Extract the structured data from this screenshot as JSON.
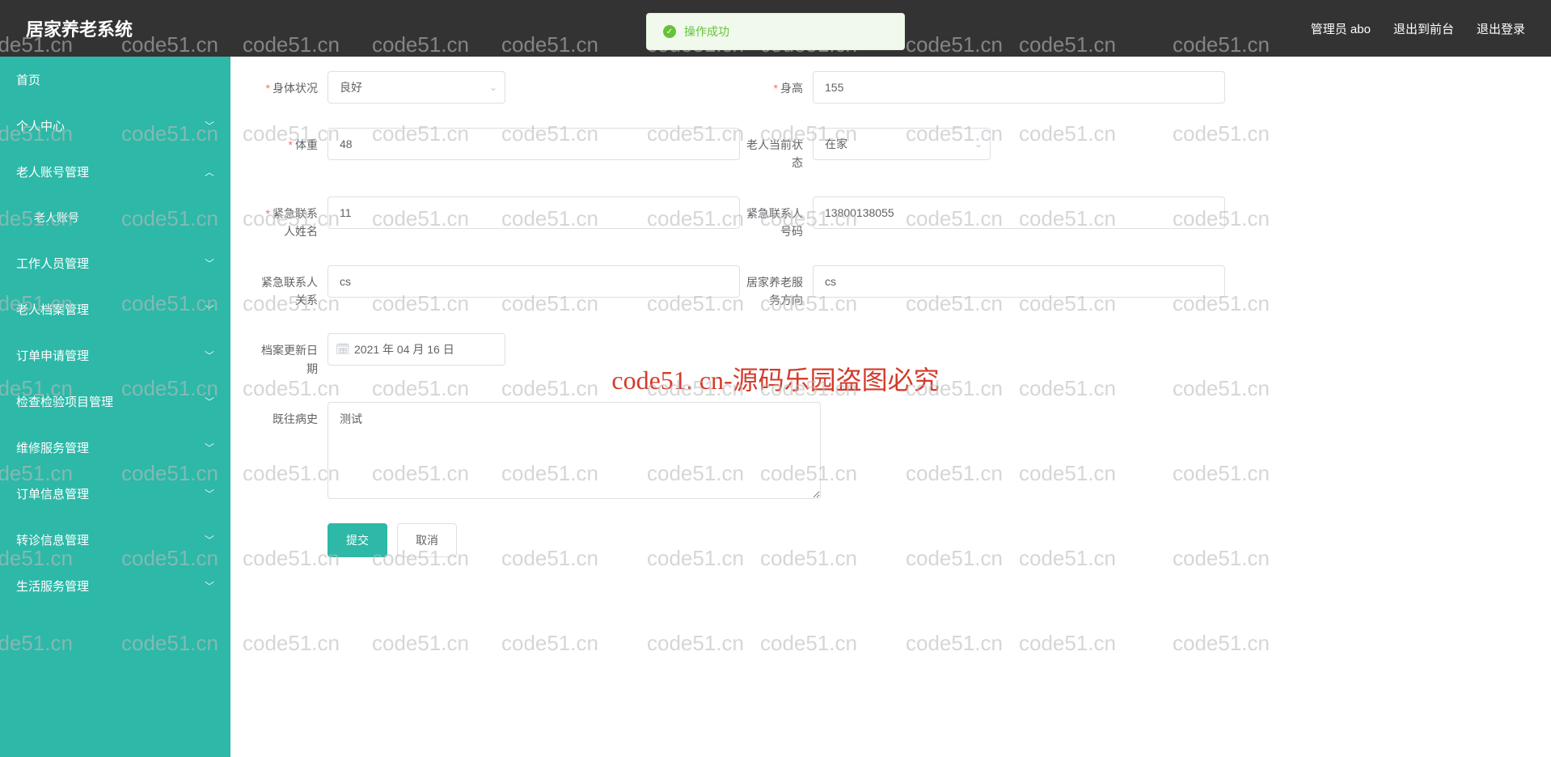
{
  "header": {
    "title": "居家养老系统",
    "user": "管理员 abo",
    "front": "退出到前台",
    "logout": "退出登录"
  },
  "toast": {
    "text": "操作成功"
  },
  "sidebar": {
    "items": [
      {
        "label": "首页",
        "arrow": ""
      },
      {
        "label": "个人中心",
        "arrow": "﹀"
      },
      {
        "label": "老人账号管理",
        "arrow": "︿"
      },
      {
        "label": "老人账号",
        "sub": true,
        "arrow": ""
      },
      {
        "label": "工作人员管理",
        "arrow": "﹀"
      },
      {
        "label": "老人档案管理",
        "arrow": "﹀"
      },
      {
        "label": "订单申请管理",
        "arrow": "﹀"
      },
      {
        "label": "检查检验项目管理",
        "arrow": "﹀"
      },
      {
        "label": "维修服务管理",
        "arrow": "﹀"
      },
      {
        "label": "订单信息管理",
        "arrow": "﹀"
      },
      {
        "label": "转诊信息管理",
        "arrow": "﹀"
      },
      {
        "label": "生活服务管理",
        "arrow": "﹀"
      }
    ]
  },
  "form": {
    "body_status": {
      "label": "身体状况",
      "value": "良好",
      "required": true
    },
    "height": {
      "label": "身高",
      "value": "155",
      "required": true
    },
    "weight": {
      "label": "体重",
      "value": "48",
      "required": true
    },
    "elder_state": {
      "label": "老人当前状态",
      "value": "在家"
    },
    "contact_name": {
      "label": "紧急联系人姓名",
      "value": "11",
      "required": true
    },
    "contact_phone": {
      "label": "紧急联系人号码",
      "value": "13800138055"
    },
    "contact_relation": {
      "label": "紧急联系人关系",
      "value": "cs"
    },
    "home_service": {
      "label": "居家养老服务方向",
      "value": "cs"
    },
    "update_date": {
      "label": "档案更新日期",
      "value": "2021 年 04 月 16 日"
    },
    "history": {
      "label": "既往病史",
      "value": "测试"
    },
    "submit": "提交",
    "cancel": "取消"
  },
  "watermark": {
    "small": "code51.cn",
    "center": "code51. cn-源码乐园盗图必究"
  }
}
